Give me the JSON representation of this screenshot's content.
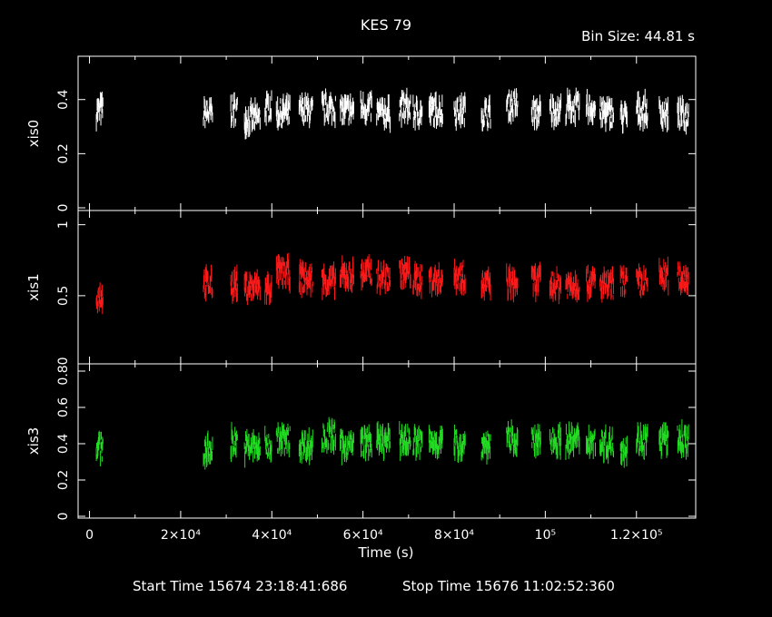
{
  "header": {
    "title": "KES 79",
    "bin_size": "Bin Size: 44.81 s"
  },
  "footer": {
    "start_time": "Start Time 15674 23:18:41:686",
    "stop_time": "Stop Time 15676 11:02:52:360"
  },
  "chart_data": {
    "type": "scatter",
    "xlabel": "Time (s)",
    "xlim": [
      -2500,
      133000
    ],
    "x_ticks": [
      {
        "value": 0,
        "label": "0"
      },
      {
        "value": 20000,
        "label": "2×10⁴"
      },
      {
        "value": 40000,
        "label": "4×10⁴"
      },
      {
        "value": 60000,
        "label": "6×10⁴"
      },
      {
        "value": 80000,
        "label": "8×10⁴"
      },
      {
        "value": 100000,
        "label": "10⁵"
      },
      {
        "value": 120000,
        "label": "1.2×10⁵"
      }
    ],
    "segments": [
      [
        1500,
        3000
      ],
      [
        25000,
        27000
      ],
      [
        31000,
        32500
      ],
      [
        34000,
        37500
      ],
      [
        38500,
        40000
      ],
      [
        41000,
        44000
      ],
      [
        46000,
        49000
      ],
      [
        51000,
        54000
      ],
      [
        55000,
        58000
      ],
      [
        59500,
        62000
      ],
      [
        63000,
        66000
      ],
      [
        68000,
        70500
      ],
      [
        71000,
        73000
      ],
      [
        74500,
        77500
      ],
      [
        80000,
        82500
      ],
      [
        86000,
        88000
      ],
      [
        91500,
        94000
      ],
      [
        97000,
        99000
      ],
      [
        101000,
        103500
      ],
      [
        104500,
        107500
      ],
      [
        109000,
        111000
      ],
      [
        112000,
        115000
      ],
      [
        116500,
        118000
      ],
      [
        120000,
        122500
      ],
      [
        125000,
        127000
      ],
      [
        129000,
        131500
      ]
    ],
    "panels": [
      {
        "ylabel": "xis0",
        "color": "#ffffff",
        "ylim": [
          -0.01,
          0.56
        ],
        "y_ticks": [
          {
            "value": 0,
            "label": "0"
          },
          {
            "value": 0.2,
            "label": "0.2"
          },
          {
            "value": 0.4,
            "label": "0.4"
          }
        ],
        "segment_means": [
          0.36,
          0.35,
          0.36,
          0.33,
          0.37,
          0.35,
          0.36,
          0.37,
          0.36,
          0.37,
          0.35,
          0.37,
          0.35,
          0.36,
          0.36,
          0.35,
          0.38,
          0.35,
          0.36,
          0.37,
          0.37,
          0.35,
          0.34,
          0.36,
          0.35,
          0.34
        ]
      },
      {
        "ylabel": "xis1",
        "color": "#ff1a1a",
        "ylim": [
          0.02,
          1.1
        ],
        "y_ticks": [
          {
            "value": 0.5,
            "label": "0.5"
          },
          {
            "value": 1,
            "label": "1"
          }
        ],
        "segment_means": [
          0.5,
          0.58,
          0.58,
          0.56,
          0.55,
          0.66,
          0.62,
          0.6,
          0.64,
          0.66,
          0.63,
          0.66,
          0.61,
          0.62,
          0.64,
          0.58,
          0.59,
          0.6,
          0.58,
          0.58,
          0.6,
          0.57,
          0.6,
          0.59,
          0.64,
          0.63
        ]
      },
      {
        "ylabel": "xis3",
        "color": "#22dd22",
        "ylim": [
          -0.01,
          0.84
        ],
        "y_ticks": [
          {
            "value": 0,
            "label": "0"
          },
          {
            "value": 0.2,
            "label": "0.2"
          },
          {
            "value": 0.4,
            "label": "0.4"
          },
          {
            "value": 0.6,
            "label": "0.6"
          },
          {
            "value": 0.8,
            "label": "0.80"
          }
        ],
        "segment_means": [
          0.38,
          0.36,
          0.41,
          0.38,
          0.39,
          0.42,
          0.39,
          0.44,
          0.39,
          0.41,
          0.41,
          0.42,
          0.41,
          0.41,
          0.4,
          0.4,
          0.42,
          0.41,
          0.42,
          0.42,
          0.42,
          0.4,
          0.38,
          0.42,
          0.42,
          0.42
        ]
      }
    ]
  }
}
